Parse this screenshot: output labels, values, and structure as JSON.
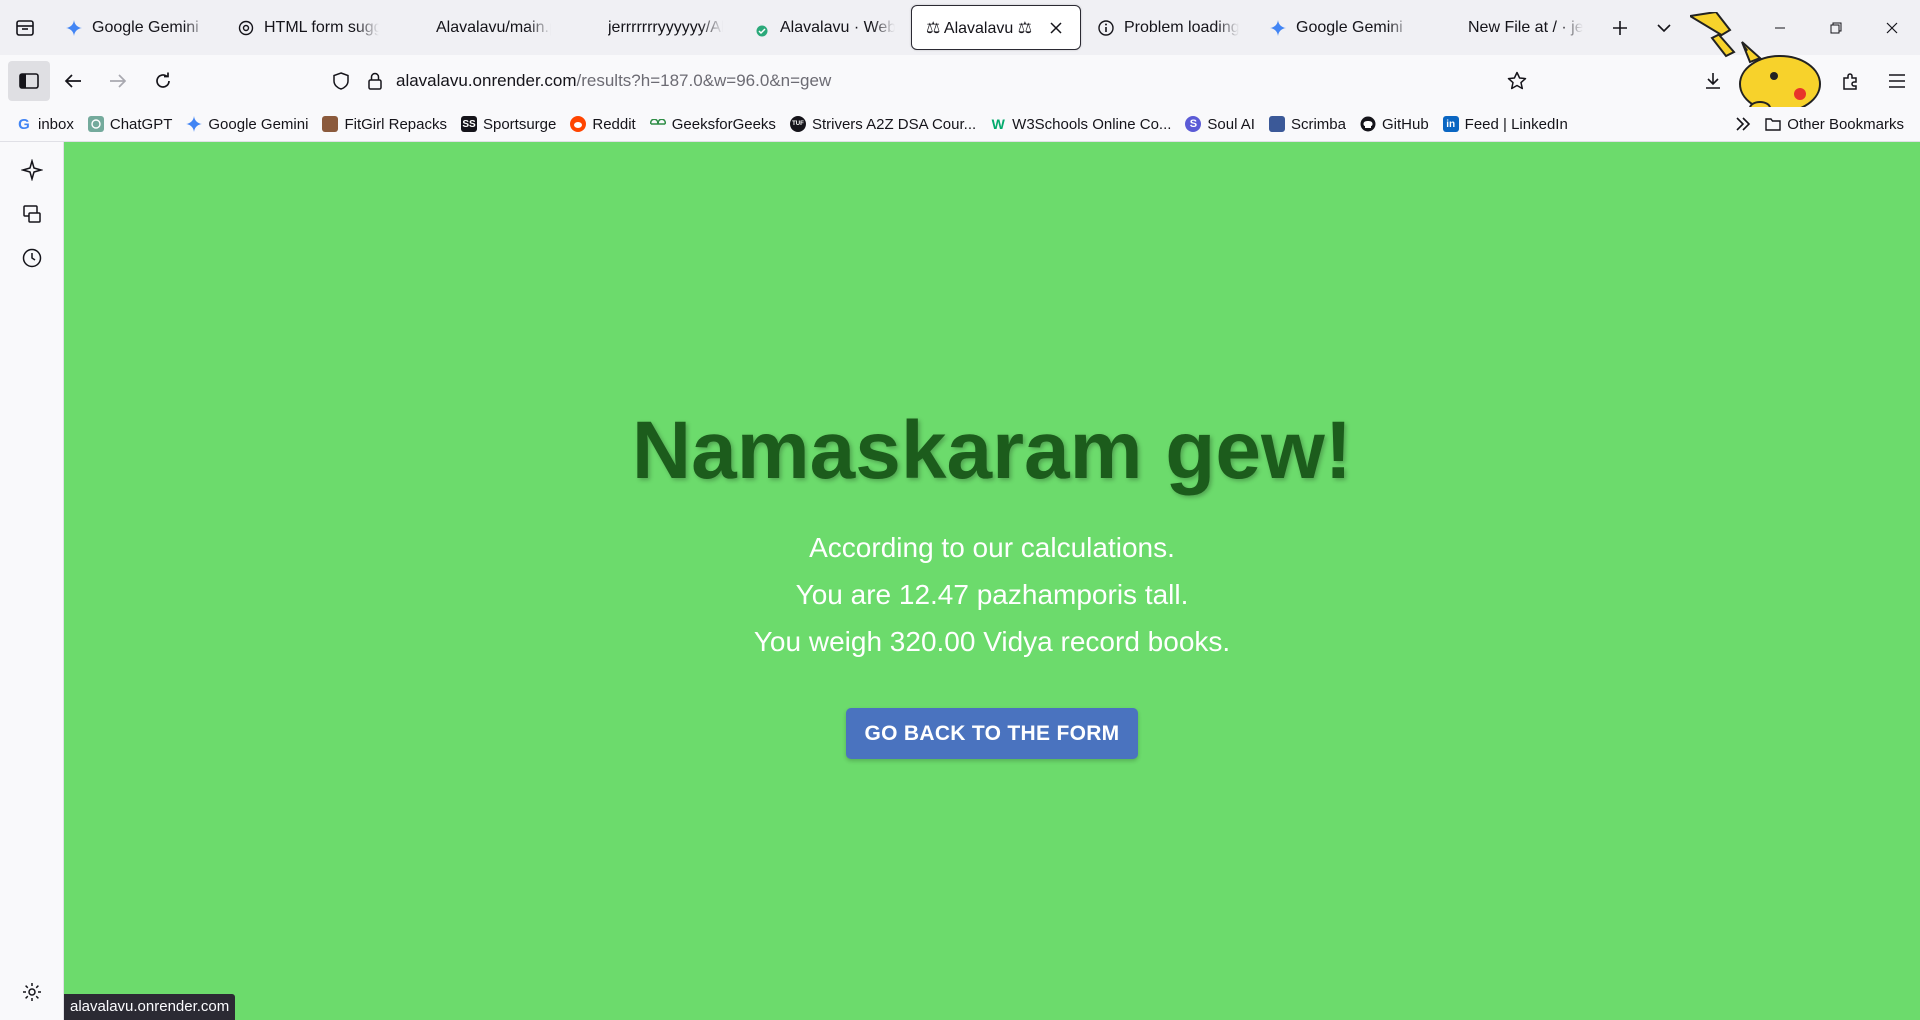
{
  "tabs": [
    {
      "title": "Google Gemini",
      "icon": "gemini-icon"
    },
    {
      "title": "HTML form suggestions",
      "icon": "chatgpt-icon"
    },
    {
      "title": "Alavalavu/main.py",
      "icon": "none"
    },
    {
      "title": "jerrrrrrryyyyyy/Alavalavu",
      "icon": "none"
    },
    {
      "title": "Alavalavu · Web Service",
      "icon": "render-check-icon"
    },
    {
      "title": "⚖ Alavalavu ⚖",
      "icon": "scales-icon",
      "active": true
    },
    {
      "title": "Problem loading page",
      "icon": "info-icon"
    },
    {
      "title": "Google Gemini",
      "icon": "gemini-icon"
    },
    {
      "title": "New File at / · jerrrrrrryyyyyy",
      "icon": "none"
    }
  ],
  "url": {
    "host": "alavalavu.onrender.com",
    "path": "/results?h=187.0&w=96.0&n=gew"
  },
  "bookmarks": [
    {
      "label": "inbox",
      "icon": "google-icon"
    },
    {
      "label": "ChatGPT",
      "icon": "chatgpt-icon"
    },
    {
      "label": "Google Gemini",
      "icon": "gemini-icon"
    },
    {
      "label": "FitGirl Repacks",
      "icon": "fitgirl-icon"
    },
    {
      "label": "Sportsurge",
      "icon": "sportsurge-icon",
      "abbr": "SS"
    },
    {
      "label": "Reddit",
      "icon": "reddit-icon"
    },
    {
      "label": "GeeksforGeeks",
      "icon": "geeksforgeeks-icon"
    },
    {
      "label": "Strivers A2Z DSA Cour...",
      "icon": "tuf-icon"
    },
    {
      "label": "W3Schools Online Co...",
      "icon": "w3schools-icon"
    },
    {
      "label": "Soul AI",
      "icon": "soulai-icon"
    },
    {
      "label": "Scrimba",
      "icon": "scrimba-icon"
    },
    {
      "label": "GitHub",
      "icon": "github-icon"
    },
    {
      "label": "Feed | LinkedIn",
      "icon": "linkedin-icon",
      "abbr": "in"
    }
  ],
  "other_bookmarks": "Other Bookmarks",
  "page": {
    "greeting": "Namaskaram gew!",
    "line1": "According to our calculations.",
    "line2": "You are 12.47 pazhamporis tall.",
    "line3": "You weigh 320.00 Vidya record books.",
    "button": "GO BACK TO THE FORM",
    "bg_color": "#6cdb6c",
    "button_color": "#4a73bf"
  },
  "status_url": "alavalavu.onrender.com"
}
